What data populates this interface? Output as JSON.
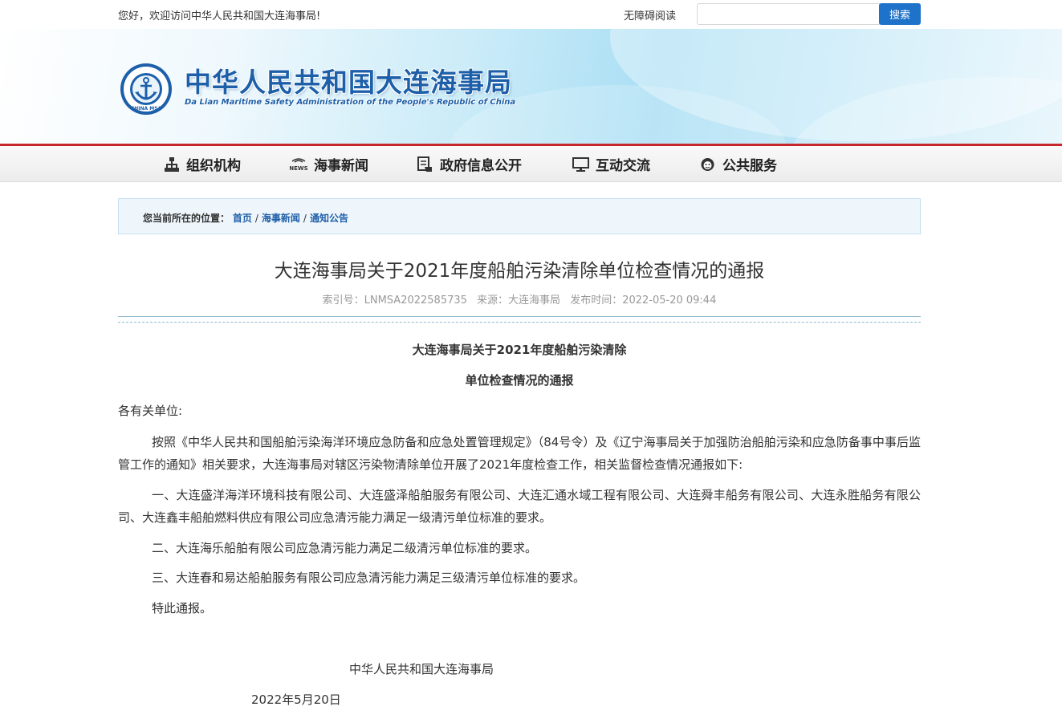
{
  "topbar": {
    "welcome": "您好，欢迎访问中华人民共和国大连海事局!",
    "accessibility": "无障碍阅读",
    "search_placeholder": "",
    "search_button": "搜索"
  },
  "banner": {
    "logo_badge_text": "CHINA MSA",
    "title_cn": "中华人民共和国大连海事局",
    "title_en": "Da Lian Maritime Safety Administration of the People's Republic of China"
  },
  "nav": {
    "items": [
      {
        "label": "组织机构",
        "icon": "org-chart-icon"
      },
      {
        "label": "海事新闻",
        "icon": "news-icon"
      },
      {
        "label": "政府信息公开",
        "icon": "document-hand-icon"
      },
      {
        "label": "互动交流",
        "icon": "monitor-icon"
      },
      {
        "label": "公共服务",
        "icon": "support-icon"
      }
    ]
  },
  "breadcrumb": {
    "label": "您当前所在的位置：",
    "items": [
      "首页",
      "海事新闻",
      "通知公告"
    ],
    "separator": "/"
  },
  "article": {
    "title": "大连海事局关于2021年度船舶污染清除单位检查情况的通报",
    "meta": {
      "index": "索引号：LNMSA2022585735",
      "source": "来源：大连海事局",
      "published": "发布时间：2022-05-20 09:44"
    },
    "heading_line1": "大连海事局关于2021年度船舶污染清除",
    "heading_line2": "单位检查情况的通报",
    "salutation": "各有关单位:",
    "paragraphs": [
      "按照《中华人民共和国船舶污染海洋环境应急防备和应急处置管理规定》（84号令）及《辽宁海事局关于加强防治船舶污染和应急防备事中事后监管工作的通知》相关要求，大连海事局对辖区污染物清除单位开展了2021年度检查工作，相关监督检查情况通报如下:",
      "一、大连盛洋海洋环境科技有限公司、大连盛泽船舶服务有限公司、大连汇通水域工程有限公司、大连舜丰船务有限公司、大连永胜船务有限公司、大连鑫丰船舶燃料供应有限公司应急清污能力满足一级清污单位标准的要求。",
      "二、大连海乐船舶有限公司应急清污能力满足二级清污单位标准的要求。",
      "三、大连春和易达船舶服务有限公司应急清污能力满足三级清污单位标准的要求。",
      "特此通报。"
    ],
    "signature": "中华人民共和国大连海事局",
    "date": "2022年5月20日"
  },
  "colors": {
    "accent_red": "#c7262c",
    "link_blue": "#1f5fa8",
    "button_blue": "#1f72c9"
  }
}
